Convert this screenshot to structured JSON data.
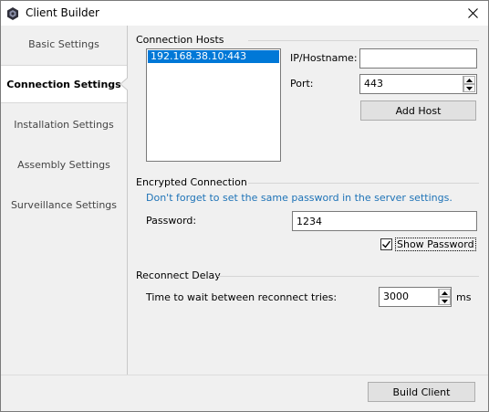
{
  "window": {
    "title": "Client Builder",
    "icon": "app-shield-icon",
    "close_icon": "close-icon"
  },
  "sidebar": {
    "items": [
      {
        "label": "Basic Settings",
        "active": false
      },
      {
        "label": "Connection Settings",
        "active": true
      },
      {
        "label": "Installation Settings",
        "active": false
      },
      {
        "label": "Assembly Settings",
        "active": false
      },
      {
        "label": "Surveillance Settings",
        "active": false
      }
    ]
  },
  "connection_hosts": {
    "title": "Connection Hosts",
    "hosts": [
      "192.168.38.10:443"
    ],
    "ip_label": "IP/Hostname:",
    "ip_value": "",
    "port_label": "Port:",
    "port_value": "443",
    "add_host_label": "Add Host"
  },
  "encrypted": {
    "title": "Encrypted Connection",
    "hint": "Don't forget to set the same password in the server settings.",
    "password_label": "Password:",
    "password_value": "1234",
    "show_password_label": "Show Password",
    "show_password_checked": true
  },
  "reconnect": {
    "title": "Reconnect Delay",
    "wait_label": "Time to wait between reconnect tries:",
    "wait_value": "3000",
    "unit": "ms"
  },
  "footer": {
    "build_label": "Build Client"
  },
  "colors": {
    "accent": "#0078d7",
    "hint": "#1e73b7",
    "window_bg": "#f0f0f0"
  }
}
